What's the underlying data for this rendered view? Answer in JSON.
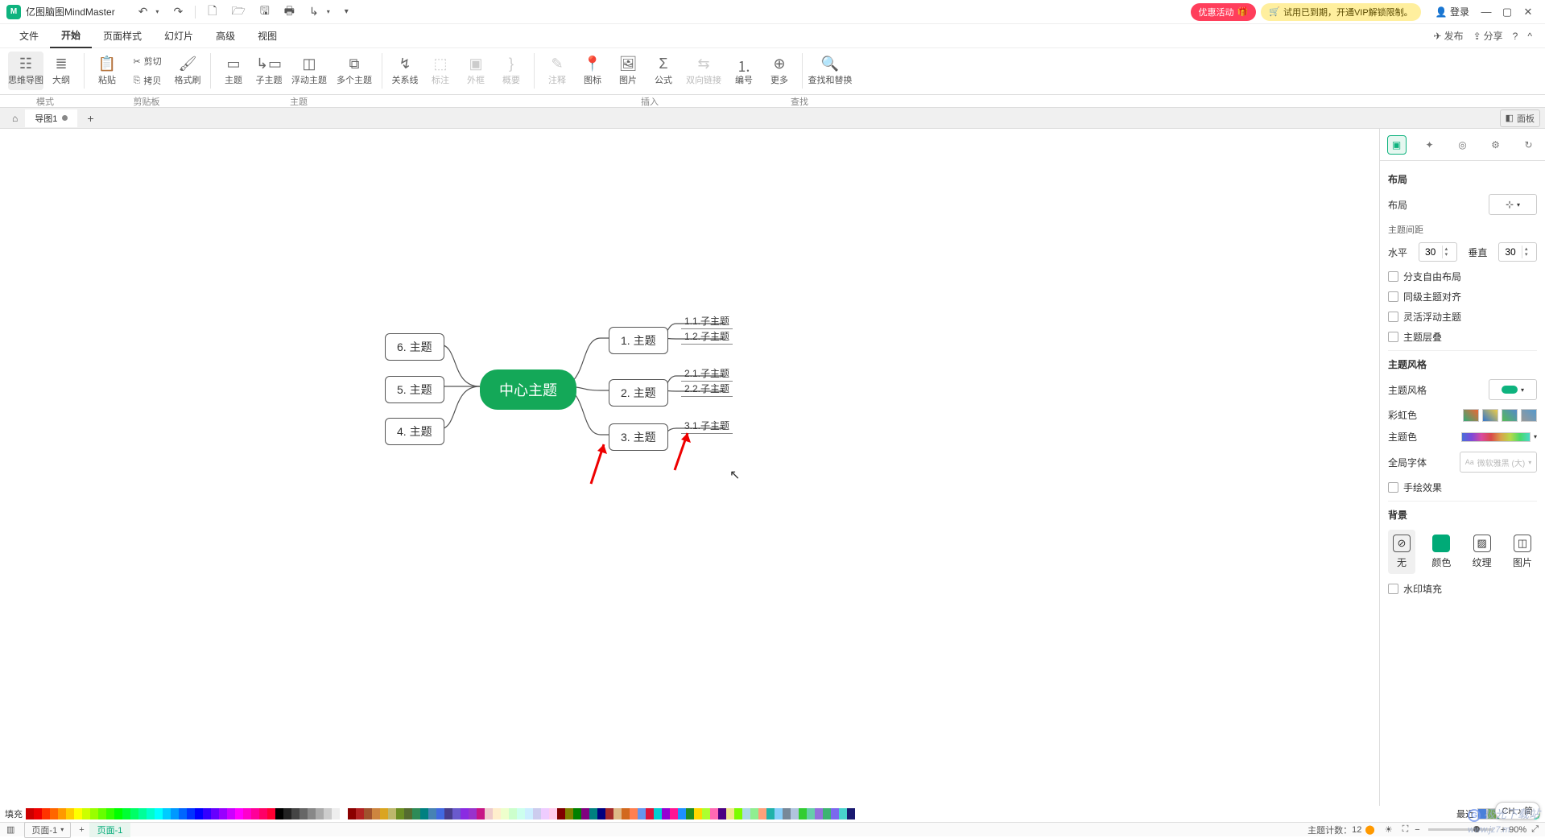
{
  "titlebar": {
    "app_name": "亿图脑图MindMaster",
    "promo1": "优惠活动",
    "promo2": "试用已到期，开通VIP解锁限制。",
    "login": "登录"
  },
  "menu": {
    "items": [
      "文件",
      "开始",
      "页面样式",
      "幻灯片",
      "高级",
      "视图"
    ],
    "active_index": 1,
    "publish": "发布",
    "share": "分享"
  },
  "ribbon": {
    "mode_group": {
      "mindmap": "思维导图",
      "outline": "大纲",
      "label": "模式"
    },
    "clip_group": {
      "paste": "粘贴",
      "cut": "剪切",
      "copy": "拷贝",
      "format_painter": "格式刷",
      "label": "剪贴板"
    },
    "topic_group": {
      "topic": "主题",
      "subtopic": "子主题",
      "floating": "浮动主题",
      "multi": "多个主题",
      "label": "主题"
    },
    "rel_group": {
      "relation": "关系线",
      "callout": "标注",
      "boundary": "外框",
      "summary": "概要"
    },
    "insert_group": {
      "note": "注释",
      "icon": "图标",
      "image": "图片",
      "formula": "公式",
      "hyperlink": "双向链接",
      "number": "编号",
      "more": "更多",
      "label": "插入"
    },
    "find_group": {
      "find_replace": "查找和替换",
      "label": "查找"
    }
  },
  "docstrip": {
    "tab1": "导图1",
    "panel_toggle": "面板"
  },
  "mindmap": {
    "central": "中心主题",
    "t1": "1. 主题",
    "t1_1": "1.1.子主题",
    "t1_2": "1.2.子主题",
    "t2": "2. 主题",
    "t2_1": "2.1.子主题",
    "t2_2": "2.2.子主题",
    "t3": "3. 主题",
    "t3_1": "3.1.子主题",
    "t4": "4. 主题",
    "t5": "5. 主题",
    "t6": "6. 主题"
  },
  "panel": {
    "sec_layout": "布局",
    "layout_lbl": "布局",
    "spacing_title": "主题间距",
    "h_lbl": "水平",
    "h_val": "30",
    "v_lbl": "垂直",
    "v_val": "30",
    "chk_free": "分支自由布局",
    "chk_align": "同级主题对齐",
    "chk_float": "灵活浮动主题",
    "chk_collapse": "主题层叠",
    "sec_style": "主题风格",
    "style_lbl": "主题风格",
    "rainbow_lbl": "彩虹色",
    "color_lbl": "主题色",
    "font_lbl": "全局字体",
    "font_val": "微软雅黑 (大)",
    "chk_hand": "手绘效果",
    "sec_bg": "背景",
    "bg_none": "无",
    "bg_color": "颜色",
    "bg_texture": "纹理",
    "bg_image": "图片",
    "chk_watermark": "水印填充"
  },
  "colorbar": {
    "fill_lbl": "填充",
    "recent_lbl": "最近",
    "ime": "CH ♪ 简"
  },
  "statusbar": {
    "page_sel": "页面-1",
    "page_tab": "页面-1",
    "topic_count_lbl": "主题计数：",
    "topic_count": "12",
    "zoom": "90%"
  },
  "watermark": {
    "site": "www.jz7.m",
    "brand": "极光下载站"
  }
}
